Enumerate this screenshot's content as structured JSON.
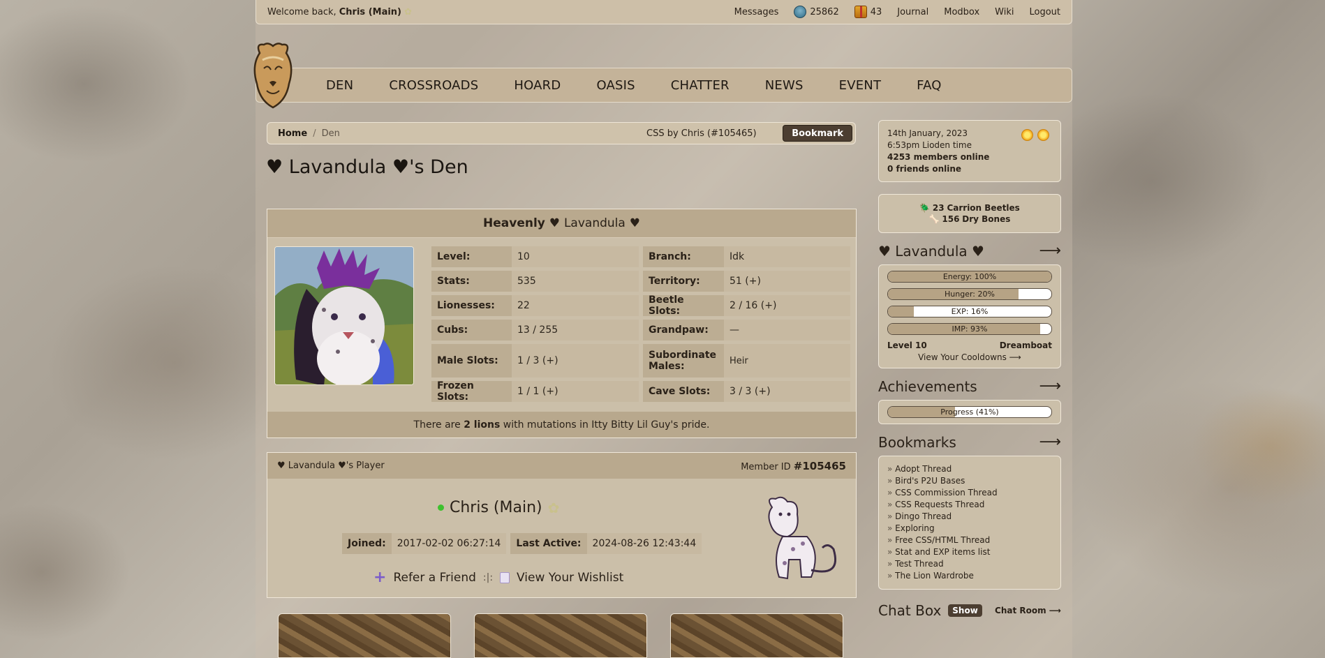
{
  "topbar": {
    "welcome_prefix": "Welcome back,",
    "username": "Chris (Main)",
    "messages": "Messages",
    "beetles": "25862",
    "gifts": "43",
    "journal": "Journal",
    "modbox": "Modbox",
    "wiki": "Wiki",
    "logout": "Logout"
  },
  "nav": [
    "DEN",
    "CROSSROADS",
    "HOARD",
    "OASIS",
    "CHATTER",
    "NEWS",
    "EVENT",
    "FAQ"
  ],
  "breadcrumb": {
    "home": "Home",
    "sep": "/",
    "current": "Den",
    "css_credit": "CSS by Chris (#105465)",
    "bookmark": "Bookmark"
  },
  "page_title": "♥ Lavandula ♥'s Den",
  "den": {
    "heading_bold": "Heavenly ♥",
    "heading_name": "Lavandula",
    "heading_end": "♥",
    "stats": [
      [
        {
          "k": "Level:",
          "v": "10"
        },
        {
          "k": "Branch:",
          "v": "Idk"
        }
      ],
      [
        {
          "k": "Stats:",
          "v": "535"
        },
        {
          "k": "Territory:",
          "v": "51 (+)"
        }
      ],
      [
        {
          "k": "Lionesses:",
          "v": "22"
        },
        {
          "k": "Beetle Slots:",
          "v": "2 / 16 (+)"
        }
      ],
      [
        {
          "k": "Cubs:",
          "v": "13 / 255"
        },
        {
          "k": "Grandpaw:",
          "v": "—"
        }
      ],
      [
        {
          "k": "Male Slots:",
          "v": "1 / 3 (+)"
        },
        {
          "k": "Subordinate Males:",
          "v": "Heir"
        }
      ],
      [
        {
          "k": "Frozen Slots:",
          "v": "1 / 1 (+)"
        },
        {
          "k": "Cave Slots:",
          "v": "3 / 3 (+)"
        }
      ]
    ],
    "mutation_prefix": "There are",
    "mutation_count": "2 lions",
    "mutation_suffix": "with mutations in Itty Bitty Lil Guy's pride."
  },
  "player": {
    "title": "♥ Lavandula ♥'s Player",
    "member_label": "Member ID",
    "member_id": "#105465",
    "name": "Chris (Main)",
    "joined_label": "Joined:",
    "joined": "2017-02-02 06:27:14",
    "active_label": "Last Active:",
    "active": "2024-08-26 12:43:44",
    "refer": "Refer a Friend",
    "divider": ":|:",
    "wishlist": "View Your Wishlist"
  },
  "sidebar": {
    "date": "14th January, 2023",
    "time": "6:53pm Lioden time",
    "members": "4253 members online",
    "friends": "0 friends online",
    "beetles_count": "23",
    "beetles_label": "Carrion Beetles",
    "bones_count": "156",
    "bones_label": "Dry Bones",
    "lion_title": "♥ Lavandula ♥",
    "bars": [
      {
        "label": "Energy: 100%",
        "fill": 1.0
      },
      {
        "label": "Hunger: 20%",
        "fill": 0.8
      },
      {
        "label": "EXP: 16%",
        "fill": 0.16
      },
      {
        "label": "IMP: 93%",
        "fill": 0.93
      }
    ],
    "level": "Level 10",
    "mood": "Dreamboat",
    "cooldowns": "View Your Cooldowns ⟶",
    "achievements_title": "Achievements",
    "progress": {
      "label": "Progress (41%)",
      "fill": 0.41
    },
    "bookmarks_title": "Bookmarks",
    "bookmarks": [
      "Adopt Thread",
      "Bird's P2U Bases",
      "CSS Commission Thread",
      "CSS Requests Thread",
      "Dingo Thread",
      "Exploring",
      "Free CSS/HTML Thread",
      "Stat and EXP items list",
      "Test Thread",
      "The Lion Wardrobe"
    ],
    "chat_title": "Chat Box",
    "show": "Show",
    "chat_room": "Chat Room ⟶"
  },
  "arrow": "⟶"
}
